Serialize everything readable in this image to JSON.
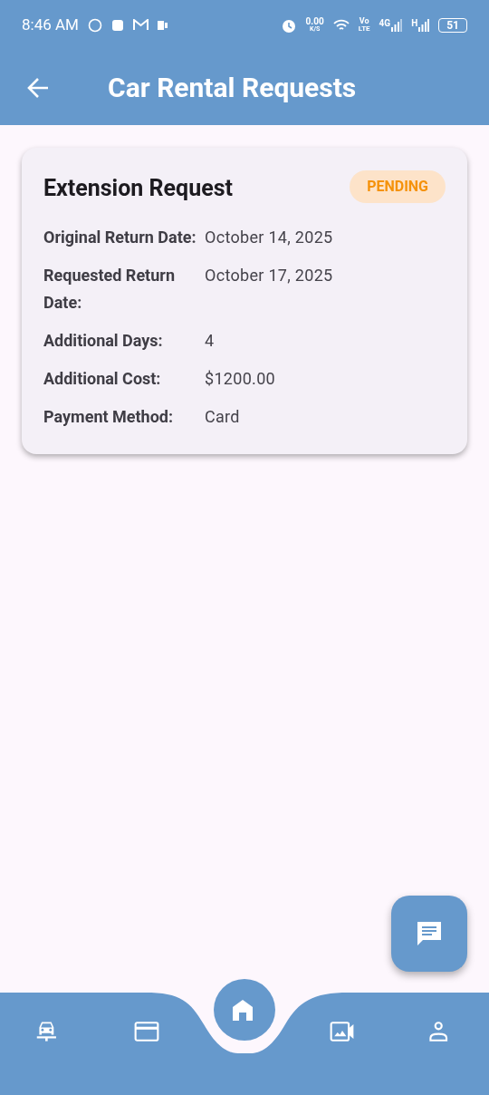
{
  "status_bar": {
    "time": "8:46 AM",
    "speed": "0.00",
    "speed_unit": "K/S",
    "volte_top": "Vo",
    "volte_bottom": "LTE",
    "network_1": "4G",
    "network_2": "H",
    "battery": "51"
  },
  "app_bar": {
    "title": "Car Rental Requests"
  },
  "card": {
    "title": "Extension Request",
    "status": "PENDING",
    "fields": [
      {
        "label": "Original Return Date:",
        "value": "October 14, 2025"
      },
      {
        "label": "Requested Return Date:",
        "value": "October 17, 2025"
      },
      {
        "label": "Additional Days:",
        "value": "4"
      },
      {
        "label": "Additional Cost:",
        "value": "$1200.00"
      },
      {
        "label": "Payment Method:",
        "value": "Card"
      }
    ]
  },
  "bottom_nav": [
    {
      "kind": "car",
      "selected": false
    },
    {
      "kind": "card",
      "selected": false
    },
    {
      "kind": "home",
      "selected": true
    },
    {
      "kind": "video",
      "selected": false
    },
    {
      "kind": "person",
      "selected": false
    }
  ]
}
